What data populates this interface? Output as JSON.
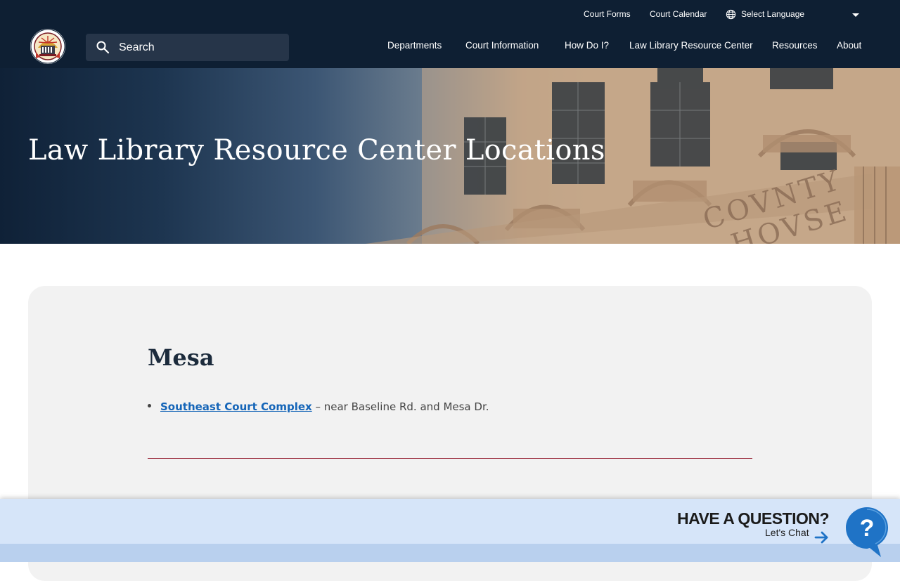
{
  "utility_nav": {
    "court_forms": "Court Forms",
    "court_calendar": "Court Calendar",
    "language": "Select Language"
  },
  "search": {
    "placeholder": "Search"
  },
  "main_nav": {
    "departments": "Departments",
    "court_information": "Court Information",
    "how_do_i": "How Do I?",
    "law_library": "Law Library Resource Center",
    "resources": "Resources",
    "about": "About"
  },
  "hero": {
    "title": "Law Library Resource Center Locations",
    "building_inscription": "COVNTY COVRT HOVSE"
  },
  "content": {
    "heading": "Mesa",
    "locations": [
      {
        "link": "Southeast Court Complex",
        "description": " – near Baseline Rd. and Mesa Dr."
      }
    ]
  },
  "chat": {
    "heading": "HAVE A QUESTION?",
    "sub": "Let's Chat",
    "bubble_symbol": "?"
  },
  "colors": {
    "header_bg": "#0e1f33",
    "link": "#1565b8",
    "divider": "#9d3042",
    "chat_bar": "#d6e5f9",
    "chat_bubble": "#1f73c6"
  },
  "icons": [
    "globe-icon",
    "caret-down-icon",
    "search-icon",
    "arrow-right-icon",
    "chat-bubble-icon",
    "court-seal-logo"
  ]
}
